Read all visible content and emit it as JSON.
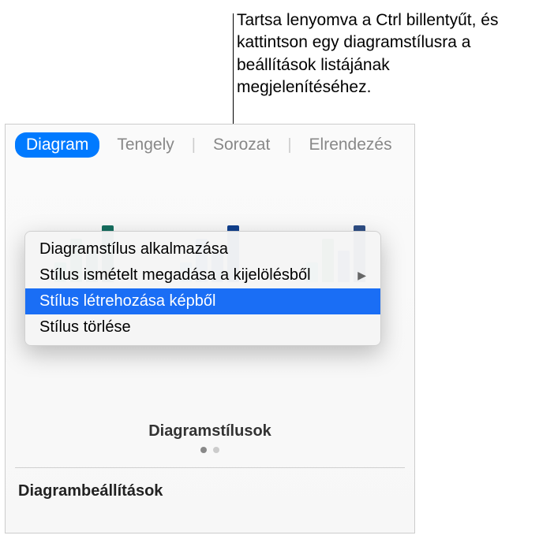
{
  "callout": {
    "text": "Tartsa lenyomva a Ctrl billentyűt, és kattintson egy diagramstílusra a beállítások listájának megjelenítéséhez."
  },
  "tabs": {
    "diagram": "Diagram",
    "axis": "Tengely",
    "series": "Sorozat",
    "layout": "Elrendezés"
  },
  "thumbs": [
    {
      "colors": [
        "#2fbfa3",
        "#2aa58d",
        "#1e8a77",
        "#166f60"
      ],
      "heights": [
        25,
        55,
        40,
        72
      ]
    },
    {
      "colors": [
        "#5bb8e8",
        "#3a8ed8",
        "#1e5fb5",
        "#11418f"
      ],
      "heights": [
        25,
        55,
        40,
        72
      ]
    },
    {
      "colors": [
        "#69cddf",
        "#4f9f6d",
        "#3d6fb0",
        "#2e4e85"
      ],
      "heights": [
        25,
        55,
        40,
        72
      ]
    }
  ],
  "contextMenu": {
    "applyStyle": "Diagramstílus alkalmazása",
    "redefine": "Stílus ismételt megadása a kijelölésből",
    "createFromImage": "Stílus létrehozása képből",
    "deleteStyle": "Stílus törlése"
  },
  "stylesSection": {
    "title": "Diagramstílusok"
  },
  "settingsSection": {
    "title": "Diagrambeállítások"
  }
}
